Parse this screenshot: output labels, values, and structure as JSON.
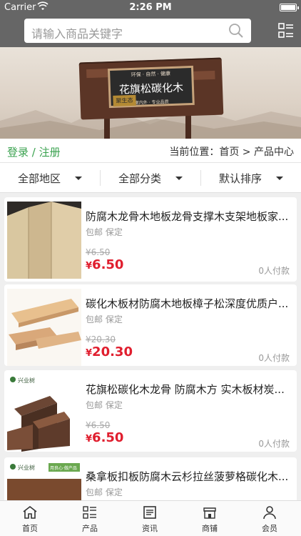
{
  "status_bar": {
    "carrier": "Carrier",
    "time": "2:26 PM"
  },
  "search": {
    "placeholder": "请输入商品关键字"
  },
  "banner": {
    "top_text": "环保 · 自然 · 健康",
    "title": "花旗松碳化木",
    "subtitle": "室内外 · 专业品质",
    "badge": "聚生态"
  },
  "infobar": {
    "login": "登录",
    "separator": "/",
    "register": "注册",
    "breadcrumb": "当前位置：首页 > 产品中心"
  },
  "filters": [
    "全部地区",
    "全部分类",
    "默认排序"
  ],
  "products": [
    {
      "title": "防腐木龙骨木地板龙骨支撑木支架地板家...",
      "tags": "包邮  保定",
      "old_price": "¥6.50",
      "price_symbol": "¥",
      "price": "6.50",
      "paid": "0人付款"
    },
    {
      "title": "碳化木板材防腐木地板樟子松深度优质户...",
      "tags": "包邮  保定",
      "old_price": "¥20.30",
      "price_symbol": "¥",
      "price": "20.30",
      "paid": "0人付款"
    },
    {
      "title": "花旗松碳化木龙骨 防腐木方 实木板材炭...",
      "tags": "包邮  保定",
      "old_price": "¥6.50",
      "price_symbol": "¥",
      "price": "6.50",
      "paid": "0人付款",
      "logo": "兴业树"
    },
    {
      "title": "桑拿板扣板防腐木云杉拉丝菠萝格碳化木...",
      "tags": "包邮  保定",
      "logo": "兴业树",
      "logo_tag": "用良心·做产品"
    }
  ],
  "tabbar": [
    "首页",
    "产品",
    "资讯",
    "商铺",
    "会员"
  ],
  "colors": {
    "header": "#666666",
    "accent_green": "#3aa24f",
    "price_red": "#e01e2e"
  }
}
